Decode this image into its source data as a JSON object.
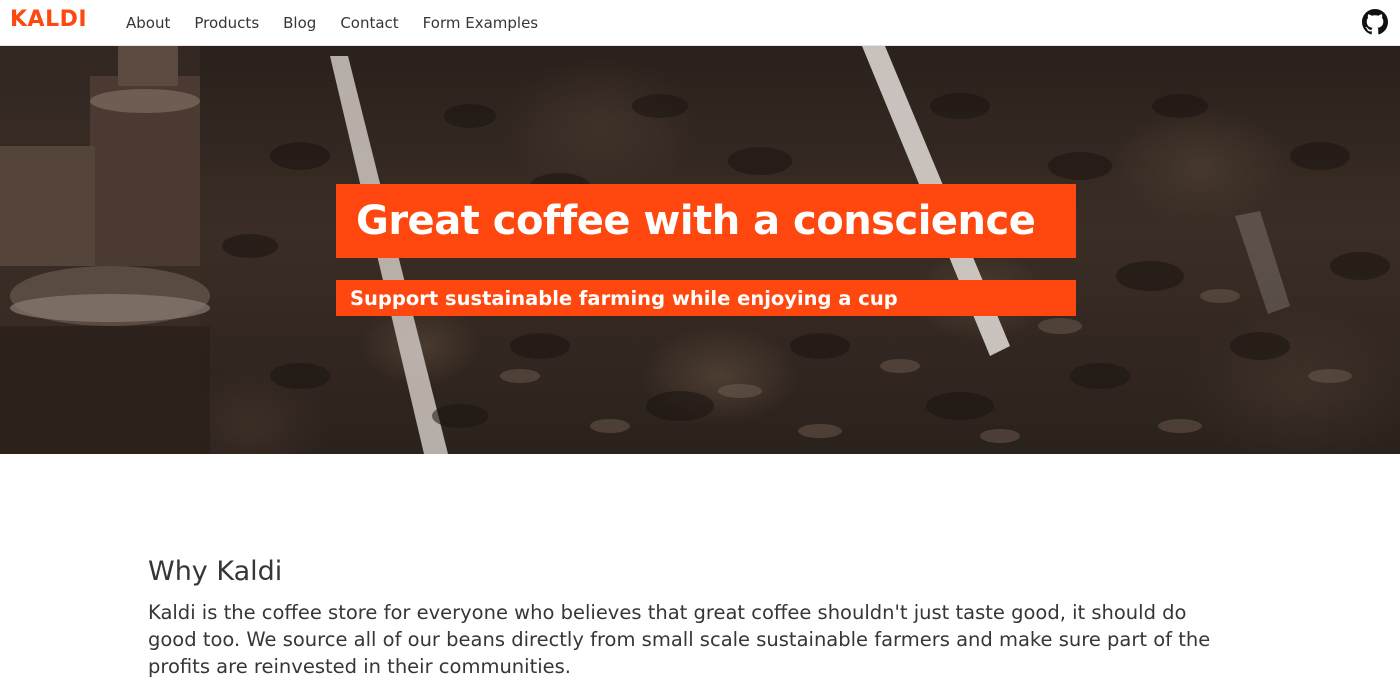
{
  "navbar": {
    "logo": "KALDI",
    "links": [
      {
        "label": "About"
      },
      {
        "label": "Products"
      },
      {
        "label": "Blog"
      },
      {
        "label": "Contact"
      },
      {
        "label": "Form Examples"
      }
    ],
    "github_icon": "github-icon"
  },
  "hero": {
    "title": "Great coffee with a conscience",
    "subtitle": "Support sustainable farming while enjoying a cup"
  },
  "main": {
    "heading": "Why Kaldi",
    "body": "Kaldi is the coffee store for everyone who believes that great coffee shouldn't just taste good, it should do good too. We source all of our beans directly from small scale sustainable farmers and make sure part of the profits are reinvested in their communities."
  },
  "colors": {
    "accent": "#ff470f",
    "text": "#363636",
    "background": "#ffffff"
  }
}
